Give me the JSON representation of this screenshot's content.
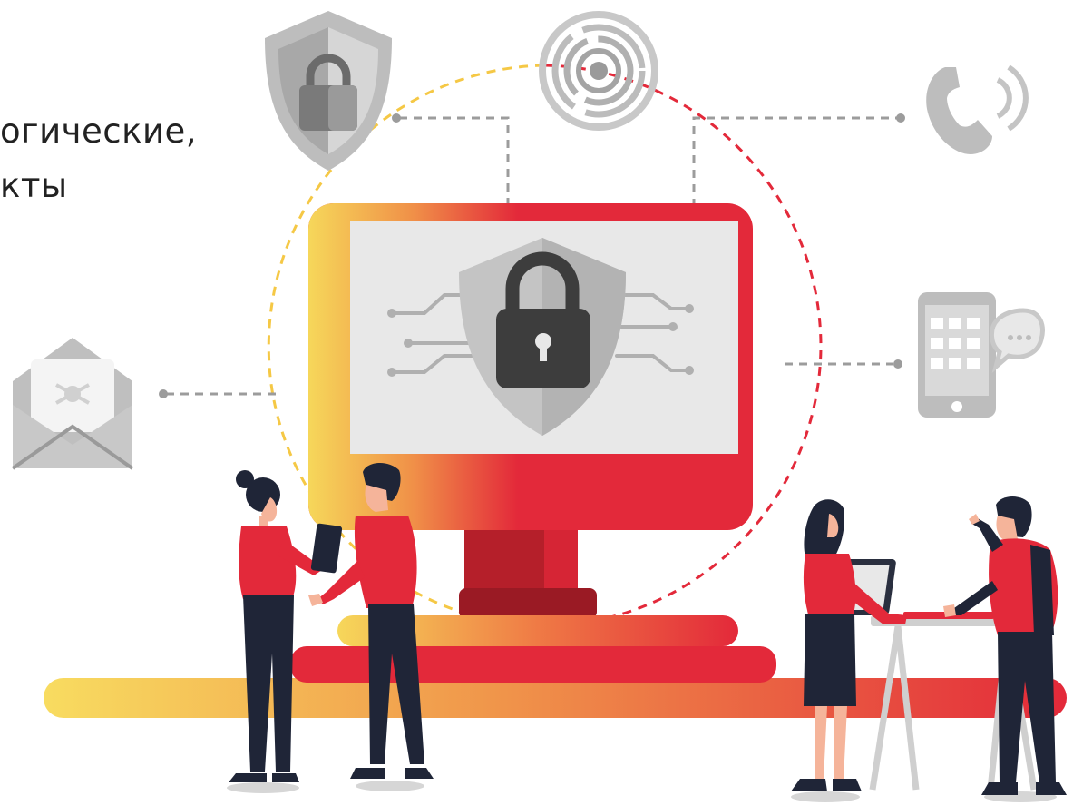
{
  "heading": {
    "line1": "огические,",
    "line2": "кты"
  },
  "colors": {
    "brand_red": "#e3293a",
    "dark_red": "#b51f2a",
    "yellow": "#f6d75a",
    "orange": "#f0944a",
    "navy": "#1f2537",
    "gray": "#bdbdbd",
    "dark_gray": "#4a4a4a"
  },
  "icons": [
    "shield-lock-icon",
    "fingerprint-icon",
    "phone-call-icon",
    "malware-envelope-icon",
    "smartphone-chat-icon",
    "monitor-padlock-icon"
  ]
}
